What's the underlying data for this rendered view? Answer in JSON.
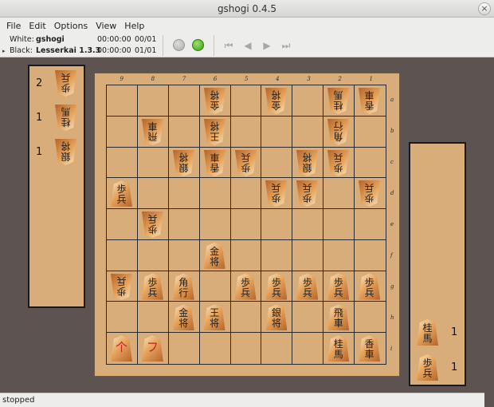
{
  "window": {
    "title": "gshogi 0.4.5",
    "close_glyph": "×"
  },
  "menu": [
    "File",
    "Edit",
    "Options",
    "View",
    "Help"
  ],
  "players": {
    "white": {
      "label": "White:",
      "name": "gshogi",
      "clock": "00:00:00",
      "moves": "00/01"
    },
    "black": {
      "label": "Black:",
      "name": "Lesserkai 1.3.3",
      "clock": "00:00:00",
      "moves": "01/01",
      "expander": "▸"
    }
  },
  "nav_icons": [
    "first-move-icon",
    "previous-move-icon",
    "next-move-icon",
    "last-move-icon"
  ],
  "nav_glyphs": [
    "⏮",
    "◀",
    "▶",
    "⏭"
  ],
  "board": {
    "files": [
      "9",
      "8",
      "7",
      "6",
      "5",
      "4",
      "3",
      "2",
      "1"
    ],
    "ranks": [
      "a",
      "b",
      "c",
      "d",
      "e",
      "f",
      "g",
      "h",
      "i"
    ],
    "pieces": [
      {
        "file": 6,
        "rank": "a",
        "owner": "white",
        "glyphs": [
          "金",
          "将"
        ]
      },
      {
        "file": 4,
        "rank": "a",
        "owner": "white",
        "glyphs": [
          "金",
          "将"
        ]
      },
      {
        "file": 2,
        "rank": "a",
        "owner": "white",
        "glyphs": [
          "桂",
          "馬"
        ]
      },
      {
        "file": 1,
        "rank": "a",
        "owner": "white",
        "glyphs": [
          "香",
          "車"
        ]
      },
      {
        "file": 8,
        "rank": "b",
        "owner": "white",
        "glyphs": [
          "飛",
          "車"
        ]
      },
      {
        "file": 6,
        "rank": "b",
        "owner": "white",
        "glyphs": [
          "王",
          "将"
        ]
      },
      {
        "file": 2,
        "rank": "b",
        "owner": "white",
        "glyphs": [
          "角",
          "行"
        ]
      },
      {
        "file": 7,
        "rank": "c",
        "owner": "white",
        "glyphs": [
          "銀",
          "将"
        ]
      },
      {
        "file": 6,
        "rank": "c",
        "owner": "white",
        "glyphs": [
          "香",
          "車"
        ]
      },
      {
        "file": 5,
        "rank": "c",
        "owner": "white",
        "glyphs": [
          "歩",
          "兵"
        ]
      },
      {
        "file": 3,
        "rank": "c",
        "owner": "white",
        "glyphs": [
          "銀",
          "将"
        ]
      },
      {
        "file": 2,
        "rank": "c",
        "owner": "white",
        "glyphs": [
          "歩",
          "兵"
        ]
      },
      {
        "file": 9,
        "rank": "d",
        "owner": "black",
        "glyphs": [
          "歩",
          "兵"
        ]
      },
      {
        "file": 4,
        "rank": "d",
        "owner": "white",
        "glyphs": [
          "歩",
          "兵"
        ]
      },
      {
        "file": 3,
        "rank": "d",
        "owner": "white",
        "glyphs": [
          "歩",
          "兵"
        ]
      },
      {
        "file": 1,
        "rank": "d",
        "owner": "white",
        "glyphs": [
          "歩",
          "兵"
        ]
      },
      {
        "file": 8,
        "rank": "e",
        "owner": "white",
        "glyphs": [
          "歩",
          "兵"
        ]
      },
      {
        "file": 6,
        "rank": "f",
        "owner": "black",
        "glyphs": [
          "金",
          "将"
        ]
      },
      {
        "file": 9,
        "rank": "g",
        "owner": "white",
        "glyphs": [
          "歩",
          "兵"
        ]
      },
      {
        "file": 8,
        "rank": "g",
        "owner": "black",
        "glyphs": [
          "歩",
          "兵"
        ]
      },
      {
        "file": 7,
        "rank": "g",
        "owner": "black",
        "glyphs": [
          "角",
          "行"
        ]
      },
      {
        "file": 5,
        "rank": "g",
        "owner": "black",
        "glyphs": [
          "歩",
          "兵"
        ]
      },
      {
        "file": 4,
        "rank": "g",
        "owner": "black",
        "glyphs": [
          "歩",
          "兵"
        ]
      },
      {
        "file": 3,
        "rank": "g",
        "owner": "black",
        "glyphs": [
          "歩",
          "兵"
        ]
      },
      {
        "file": 2,
        "rank": "g",
        "owner": "black",
        "glyphs": [
          "歩",
          "兵"
        ]
      },
      {
        "file": 1,
        "rank": "g",
        "owner": "black",
        "glyphs": [
          "歩",
          "兵"
        ]
      },
      {
        "file": 7,
        "rank": "h",
        "owner": "black",
        "glyphs": [
          "金",
          "将"
        ]
      },
      {
        "file": 6,
        "rank": "h",
        "owner": "black",
        "glyphs": [
          "王",
          "将"
        ]
      },
      {
        "file": 4,
        "rank": "h",
        "owner": "black",
        "glyphs": [
          "銀",
          "将"
        ]
      },
      {
        "file": 2,
        "rank": "h",
        "owner": "black",
        "glyphs": [
          "飛",
          "車"
        ]
      },
      {
        "file": 9,
        "rank": "i",
        "owner": "black",
        "glyphs": [
          "个"
        ],
        "promoted": true
      },
      {
        "file": 8,
        "rank": "i",
        "owner": "black",
        "glyphs": [
          "フ"
        ],
        "promoted": true
      },
      {
        "file": 2,
        "rank": "i",
        "owner": "black",
        "glyphs": [
          "桂",
          "馬"
        ]
      },
      {
        "file": 1,
        "rank": "i",
        "owner": "black",
        "glyphs": [
          "香",
          "車"
        ]
      }
    ]
  },
  "white_hand": [
    {
      "count": "2",
      "glyphs": [
        "歩",
        "兵"
      ]
    },
    {
      "count": "1",
      "glyphs": [
        "桂",
        "馬"
      ]
    },
    {
      "count": "1",
      "glyphs": [
        "銀",
        "将"
      ]
    }
  ],
  "black_hand": [
    {
      "count": "1",
      "glyphs": [
        "桂",
        "馬"
      ]
    },
    {
      "count": "1",
      "glyphs": [
        "歩",
        "兵"
      ]
    }
  ],
  "status": "stopped"
}
